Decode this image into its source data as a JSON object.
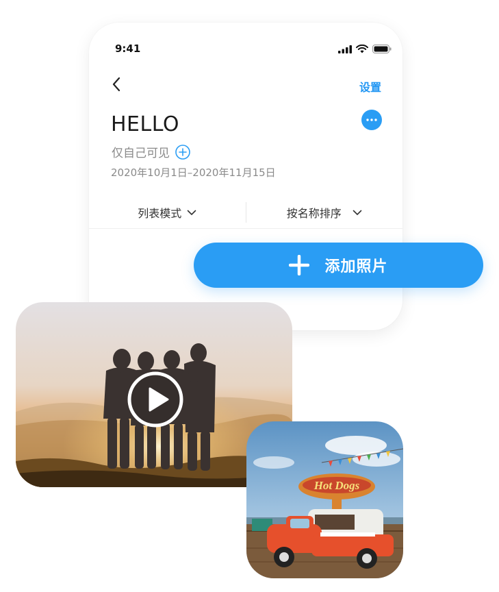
{
  "status_bar": {
    "time": "9:41",
    "icons": [
      "cellular-signal-icon",
      "wifi-icon",
      "battery-icon"
    ]
  },
  "nav": {
    "back_icon": "chevron-left-icon",
    "settings_label": "设置",
    "more_icon": "ellipsis-icon"
  },
  "album": {
    "title": "HELLO",
    "visibility": "仅自己可见",
    "visibility_add_icon": "plus-circle-icon",
    "date_range": "2020年10月1日–2020年11月15日"
  },
  "toolbar": {
    "view_mode_label": "列表模式",
    "sort_label": "按名称排序"
  },
  "add_photo": {
    "label": "添加照片",
    "icon": "plus-icon"
  },
  "photos": [
    {
      "kind": "video",
      "icon": "play-icon"
    },
    {
      "kind": "image",
      "sign_text": "Hot Dogs"
    }
  ],
  "colors": {
    "accent": "#2a9df4",
    "text_secondary": "#8a8a8a"
  }
}
